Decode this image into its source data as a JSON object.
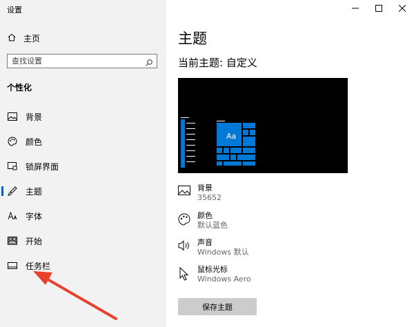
{
  "window": {
    "title": "设置"
  },
  "sidebar": {
    "home": "主页",
    "search_placeholder": "查找设置",
    "section": "个性化",
    "items": [
      {
        "label": "背景",
        "icon": "image-icon"
      },
      {
        "label": "颜色",
        "icon": "palette-icon"
      },
      {
        "label": "锁屏界面",
        "icon": "lock-screen-icon"
      },
      {
        "label": "主题",
        "icon": "brush-icon",
        "selected": true
      },
      {
        "label": "字体",
        "icon": "font-icon"
      },
      {
        "label": "开始",
        "icon": "start-menu-icon"
      },
      {
        "label": "任务栏",
        "icon": "taskbar-icon"
      }
    ]
  },
  "main": {
    "title": "主题",
    "current_theme": "当前主题: 自定义",
    "preview_tile_text": "Aa",
    "properties": [
      {
        "name": "背景",
        "value": "35652",
        "icon": "image-icon"
      },
      {
        "name": "颜色",
        "value": "默认蓝色",
        "icon": "palette-icon"
      },
      {
        "name": "声音",
        "value": "Windows 默认",
        "icon": "speaker-icon"
      },
      {
        "name": "鼠标光标",
        "value": "Windows Aero",
        "icon": "cursor-icon"
      }
    ],
    "save_button": "保存主题"
  },
  "colors": {
    "accent": "#0063b1",
    "tile_blue": "#0078d7",
    "annotation_arrow": "#e8412c"
  }
}
